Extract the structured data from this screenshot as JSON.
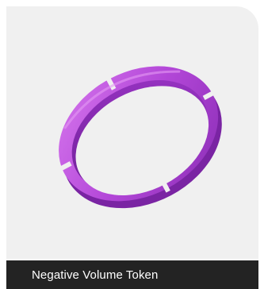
{
  "product": {
    "image_subject": "ring-token-icon",
    "caption": "Negative Volume Token"
  },
  "colors": {
    "ring_main": "#b347d8",
    "ring_highlight": "#d778ee",
    "ring_shadow": "#7a24a3",
    "panel_background": "#f0f0f0",
    "caption_background": "#232323",
    "caption_text": "#ffffff"
  }
}
